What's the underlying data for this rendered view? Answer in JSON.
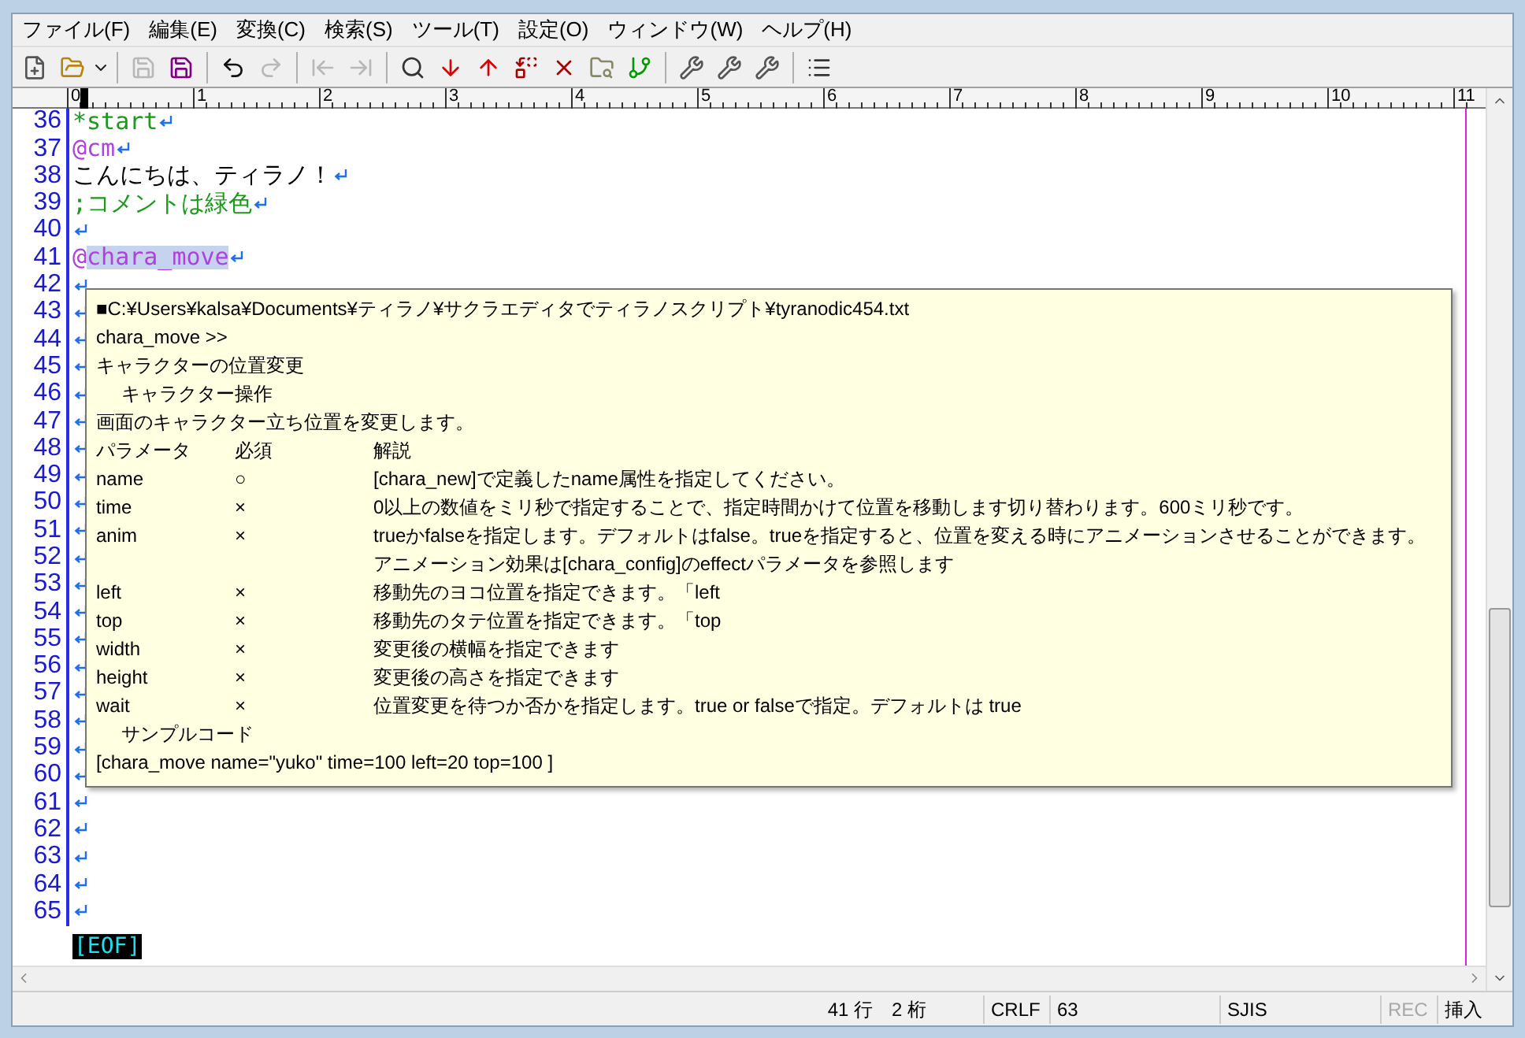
{
  "menu": [
    "ファイル(F)",
    "編集(E)",
    "変換(C)",
    "検索(S)",
    "ツール(T)",
    "設定(O)",
    "ウィンドウ(W)",
    "ヘルプ(H)"
  ],
  "toolbar": [
    {
      "kind": "new",
      "disabled": false
    },
    {
      "kind": "open",
      "disabled": false
    },
    {
      "kind": "caret",
      "disabled": false
    },
    {
      "kind": "sep"
    },
    {
      "kind": "save",
      "disabled": true
    },
    {
      "kind": "saveas",
      "disabled": false
    },
    {
      "kind": "sep"
    },
    {
      "kind": "undo",
      "disabled": false
    },
    {
      "kind": "redo",
      "disabled": true
    },
    {
      "kind": "sep"
    },
    {
      "kind": "back",
      "disabled": true
    },
    {
      "kind": "forward",
      "disabled": true
    },
    {
      "kind": "sep"
    },
    {
      "kind": "find",
      "disabled": false
    },
    {
      "kind": "finddown",
      "disabled": false
    },
    {
      "kind": "findup",
      "disabled": false
    },
    {
      "kind": "replace",
      "disabled": false
    },
    {
      "kind": "clear",
      "disabled": false
    },
    {
      "kind": "grep",
      "disabled": false
    },
    {
      "kind": "outline",
      "disabled": false
    },
    {
      "kind": "sep"
    },
    {
      "kind": "tool",
      "disabled": false
    },
    {
      "kind": "tool",
      "disabled": false
    },
    {
      "kind": "tool",
      "disabled": false
    },
    {
      "kind": "sep"
    },
    {
      "kind": "list",
      "disabled": false
    }
  ],
  "ruler": [
    "0",
    "1",
    "2",
    "3",
    "4",
    "5",
    "6",
    "7",
    "8",
    "9",
    "10",
    "11"
  ],
  "lines": [
    {
      "number": "36",
      "kind": "label",
      "text": "*start",
      "selected": false
    },
    {
      "number": "37",
      "kind": "tag",
      "prefix": "@",
      "text": "cm",
      "selected": false
    },
    {
      "number": "38",
      "kind": "text",
      "text": "こんにちは、ティラノ！",
      "selected": false
    },
    {
      "number": "39",
      "kind": "comment",
      "text": ";コメントは緑色",
      "selected": false
    },
    {
      "number": "40",
      "kind": "empty",
      "selected": false
    },
    {
      "number": "41",
      "kind": "tag",
      "prefix": "@",
      "text": "chara_move",
      "selected": true
    },
    {
      "number": "42",
      "kind": "empty",
      "selected": false
    },
    {
      "number": "43",
      "kind": "empty",
      "selected": false
    },
    {
      "number": "44",
      "kind": "empty",
      "selected": false
    },
    {
      "number": "45",
      "kind": "empty",
      "selected": false
    },
    {
      "number": "46",
      "kind": "empty",
      "selected": false
    },
    {
      "number": "47",
      "kind": "empty",
      "selected": false
    },
    {
      "number": "48",
      "kind": "empty",
      "selected": false
    },
    {
      "number": "49",
      "kind": "empty",
      "selected": false
    },
    {
      "number": "50",
      "kind": "empty",
      "selected": false
    },
    {
      "number": "51",
      "kind": "empty",
      "selected": false
    },
    {
      "number": "52",
      "kind": "empty",
      "selected": false
    },
    {
      "number": "53",
      "kind": "empty",
      "selected": false
    },
    {
      "number": "54",
      "kind": "empty",
      "selected": false
    },
    {
      "number": "55",
      "kind": "empty",
      "selected": false
    },
    {
      "number": "56",
      "kind": "empty",
      "selected": false
    },
    {
      "number": "57",
      "kind": "empty",
      "selected": false
    },
    {
      "number": "58",
      "kind": "empty",
      "selected": false
    },
    {
      "number": "59",
      "kind": "empty",
      "selected": false
    },
    {
      "number": "60",
      "kind": "empty",
      "selected": false
    },
    {
      "number": "61",
      "kind": "empty",
      "selected": false
    },
    {
      "number": "62",
      "kind": "empty",
      "selected": false
    },
    {
      "number": "63",
      "kind": "empty",
      "selected": false
    },
    {
      "number": "64",
      "kind": "empty",
      "selected": false
    },
    {
      "number": "65",
      "kind": "empty",
      "selected": false
    }
  ],
  "eof": "[EOF]",
  "tooltip": {
    "path": "■C:¥Users¥kalsa¥Documents¥ティラノ¥サクラエディタでティラノスクリプト¥tyranodic454.txt",
    "tag": "chara_move >>",
    "title": "キャラクターの位置変更",
    "category": "キャラクター操作",
    "summary": "画面のキャラクター立ち位置を変更します。",
    "columns": [
      "パラメータ",
      "必須",
      "解説"
    ],
    "rows": [
      {
        "param": "name",
        "required": "○",
        "description": "[chara_new]で定義したname属性を指定してください。"
      },
      {
        "param": "time",
        "required": "×",
        "description": "0以上の数値をミリ秒で指定することで、指定時間かけて位置を移動します切り替わります。600ミリ秒です。"
      },
      {
        "param": "anim",
        "required": "×",
        "description": "trueかfalseを指定します。デフォルトはfalse。trueを指定すると、位置を変える時にアニメーションさせることができます。"
      },
      {
        "description": "アニメーション効果は[chara_config]のeffectパラメータを参照します"
      },
      {
        "param": "left",
        "required": "×",
        "description": "移動先のヨコ位置を指定できます。「left"
      },
      {
        "param": "top",
        "required": "×",
        "description": "移動先のタテ位置を指定できます。「top"
      },
      {
        "param": "width",
        "required": "×",
        "description": "変更後の横幅を指定できます"
      },
      {
        "param": "height",
        "required": "×",
        "description": "変更後の高さを指定できます"
      },
      {
        "param": "wait",
        "required": "×",
        "description": "位置変更を待つか否かを指定します。true or falseで指定。デフォルトは true"
      }
    ],
    "sample_heading": "サンプルコード",
    "sample": "[chara_move name=\"yuko\" time=100 left=20 top=100 ]"
  },
  "status": {
    "row": "41 行",
    "column": "2 桁",
    "newline": "CRLF",
    "code": "63",
    "encoding": "SJIS",
    "rec": {
      "label": "REC",
      "disabled": true
    },
    "mode": "挿入"
  }
}
